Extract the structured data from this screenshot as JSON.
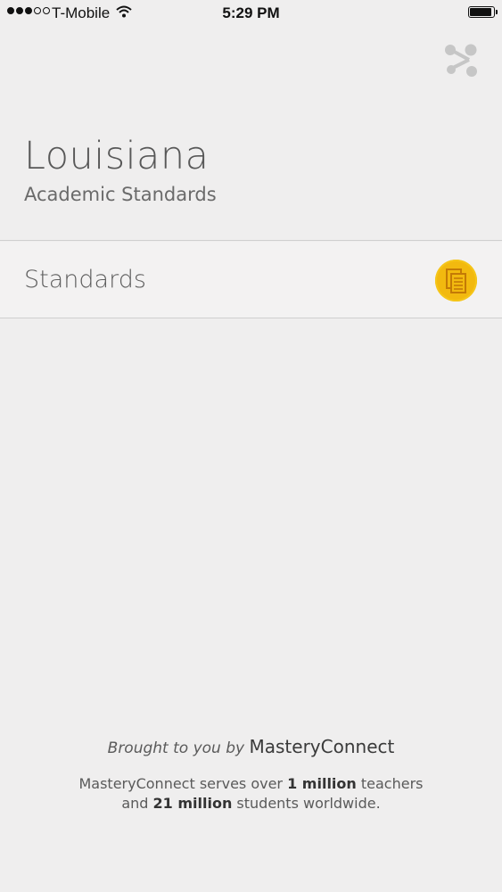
{
  "status_bar": {
    "carrier": "T-Mobile",
    "time": "5:29 PM",
    "signal_bars_filled": 3,
    "signal_bars_total": 5,
    "battery_level": 0.9
  },
  "header": {
    "title": "Louisiana",
    "subtitle": "Academic Standards"
  },
  "share_icon": "share-icon",
  "list": {
    "items": [
      {
        "label": "Standards",
        "icon": "documents-icon",
        "icon_color": "#f2b90f"
      }
    ]
  },
  "footer": {
    "brought_prefix": "Brought to you by",
    "brand": "MasteryConnect",
    "line1_a": "MasteryConnect serves over ",
    "line1_b": "1 million",
    "line1_c": " teachers",
    "line2_a": "and ",
    "line2_b": "21 million",
    "line2_c": " students worldwide."
  },
  "colors": {
    "background": "#efeeee",
    "accent": "#f2b90f",
    "text": "#5a5a5a"
  }
}
